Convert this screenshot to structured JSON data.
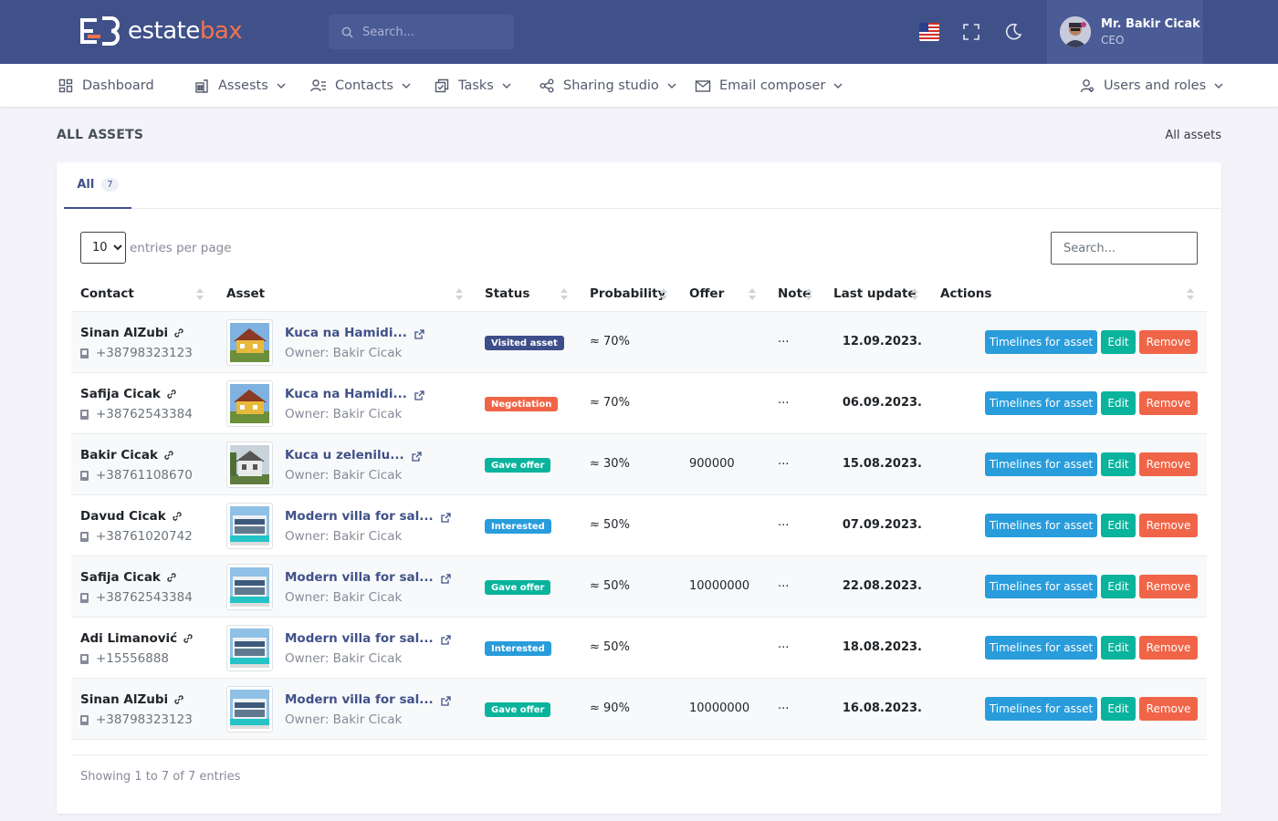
{
  "brand": {
    "part1": "estate",
    "part2": "bax"
  },
  "topbar": {
    "search_placeholder": "Search...",
    "user": {
      "name": "Mr. Bakir Cicak",
      "role": "CEO"
    }
  },
  "menu": [
    {
      "label": "Dashboard",
      "icon": "dashboard-icon",
      "chevron": false
    },
    {
      "label": "Assests",
      "icon": "building-icon",
      "chevron": true
    },
    {
      "label": "Contacts",
      "icon": "contacts-icon",
      "chevron": true
    },
    {
      "label": "Tasks",
      "icon": "tasks-icon",
      "chevron": true
    },
    {
      "label": "Sharing studio",
      "icon": "share-icon",
      "chevron": true
    },
    {
      "label": "Email composer",
      "icon": "mail-icon",
      "chevron": true
    },
    {
      "label": "Users and roles",
      "icon": "user-icon",
      "chevron": true
    }
  ],
  "page": {
    "title": "ALL ASSETS",
    "breadcrumb": "All assets"
  },
  "tabs": {
    "all_label": "All",
    "all_count": "7"
  },
  "table_controls": {
    "entries_value": "10",
    "entries_label": "entries per page",
    "search_placeholder": "Search..."
  },
  "columns": [
    "Contact",
    "Asset",
    "Status",
    "Probability",
    "Offer",
    "Note",
    "Last update",
    "Actions"
  ],
  "rows": [
    {
      "contact": "Sinan AlZubi",
      "phone": "+38798323123",
      "asset": "Kuca na Hamidi...",
      "owner": "Owner: Bakir Cicak",
      "status": "Visited asset",
      "status_color": "#3d4e8a",
      "probability": "≈ 70%",
      "offer": "",
      "note": "...",
      "date": "12.09.2023.",
      "thumb": "house-yellow"
    },
    {
      "contact": "Safija Cicak",
      "phone": "+38762543384",
      "asset": "Kuca na Hamidi...",
      "owner": "Owner: Bakir Cicak",
      "status": "Negotiation",
      "status_color": "#f06548",
      "probability": "≈ 70%",
      "offer": "",
      "note": "...",
      "date": "06.09.2023.",
      "thumb": "house-yellow"
    },
    {
      "contact": "Bakir Cicak",
      "phone": "+38761108670",
      "asset": "Kuca u zelenilu...",
      "owner": "Owner: Bakir Cicak",
      "status": "Gave offer",
      "status_color": "#0ab39c",
      "probability": "≈ 30%",
      "offer": "900000",
      "note": "...",
      "date": "15.08.2023.",
      "thumb": "house-grey"
    },
    {
      "contact": "Davud Cicak",
      "phone": "+38761020742",
      "asset": "Modern villa for sal...",
      "owner": "Owner: Bakir Cicak",
      "status": "Interested",
      "status_color": "#299cdb",
      "probability": "≈ 50%",
      "offer": "",
      "note": "...",
      "date": "07.09.2023.",
      "thumb": "villa"
    },
    {
      "contact": "Safija Cicak",
      "phone": "+38762543384",
      "asset": "Modern villa for sal...",
      "owner": "Owner: Bakir Cicak",
      "status": "Gave offer",
      "status_color": "#0ab39c",
      "probability": "≈ 50%",
      "offer": "10000000",
      "note": "...",
      "date": "22.08.2023.",
      "thumb": "villa"
    },
    {
      "contact": "Adi Limanović",
      "phone": "+15556888",
      "asset": "Modern villa for sal...",
      "owner": "Owner: Bakir Cicak",
      "status": "Interested",
      "status_color": "#299cdb",
      "probability": "≈ 50%",
      "offer": "",
      "note": "...",
      "date": "18.08.2023.",
      "thumb": "villa"
    },
    {
      "contact": "Sinan AlZubi",
      "phone": "+38798323123",
      "asset": "Modern villa for sal...",
      "owner": "Owner: Bakir Cicak",
      "status": "Gave offer",
      "status_color": "#0ab39c",
      "probability": "≈ 90%",
      "offer": "10000000",
      "note": "...",
      "date": "16.08.2023.",
      "thumb": "villa"
    }
  ],
  "actions": {
    "timelines": "Timelines for asset",
    "edit": "Edit",
    "remove": "Remove"
  },
  "footer": {
    "showing": "Showing 1 to 7 of 7 entries"
  },
  "colors": {
    "primary": "#405189",
    "accent": "#f1734f",
    "info": "#299cdb",
    "success": "#0ab39c",
    "danger": "#f06548"
  }
}
